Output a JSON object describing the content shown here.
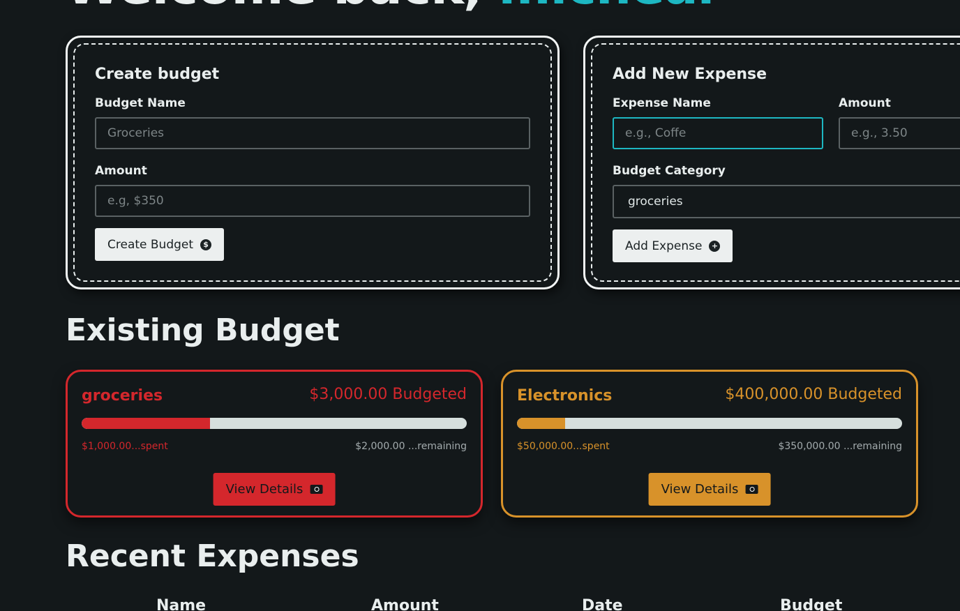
{
  "header": {
    "welcome_prefix": "Welcome back,",
    "user_name": "micheal"
  },
  "budget_form": {
    "title": "Create budget",
    "name_label": "Budget Name",
    "name_placeholder": "Groceries",
    "amount_label": "Amount",
    "amount_placeholder": "e.g, $350",
    "submit_label": "Create Budget",
    "submit_icon": "dollar-circle-icon"
  },
  "expense_form": {
    "title": "Add New Expense",
    "name_label": "Expense Name",
    "name_placeholder": "e.g., Coffe",
    "amount_label": "Amount",
    "amount_placeholder": "e.g., 3.50",
    "category_label": "Budget Category",
    "category_value": "groceries",
    "submit_label": "Add Expense",
    "submit_icon": "plus-circle-icon"
  },
  "existing": {
    "title": "Existing Budget",
    "budgets": [
      {
        "name": "groceries",
        "budgeted": "$3,000.00 Budgeted",
        "spent": "$1,000.00...spent",
        "remaining": "$2,000.00 ...remaining",
        "progress": 0.333,
        "color": "#d4272c",
        "button_label": "View Details",
        "button_icon": "cash-icon"
      },
      {
        "name": "Electronics",
        "budgeted": "$400,000.00 Budgeted",
        "spent": "$50,000.00...spent",
        "remaining": "$350,000.00 ...remaining",
        "progress": 0.125,
        "color": "#d8922a",
        "button_label": "View Details",
        "button_icon": "cash-icon"
      }
    ]
  },
  "recent": {
    "title": "Recent Expenses",
    "columns": [
      "Name",
      "Amount",
      "Date",
      "Budget"
    ]
  },
  "colors": {
    "background": "#13181a",
    "accent": "#1db7c2"
  }
}
